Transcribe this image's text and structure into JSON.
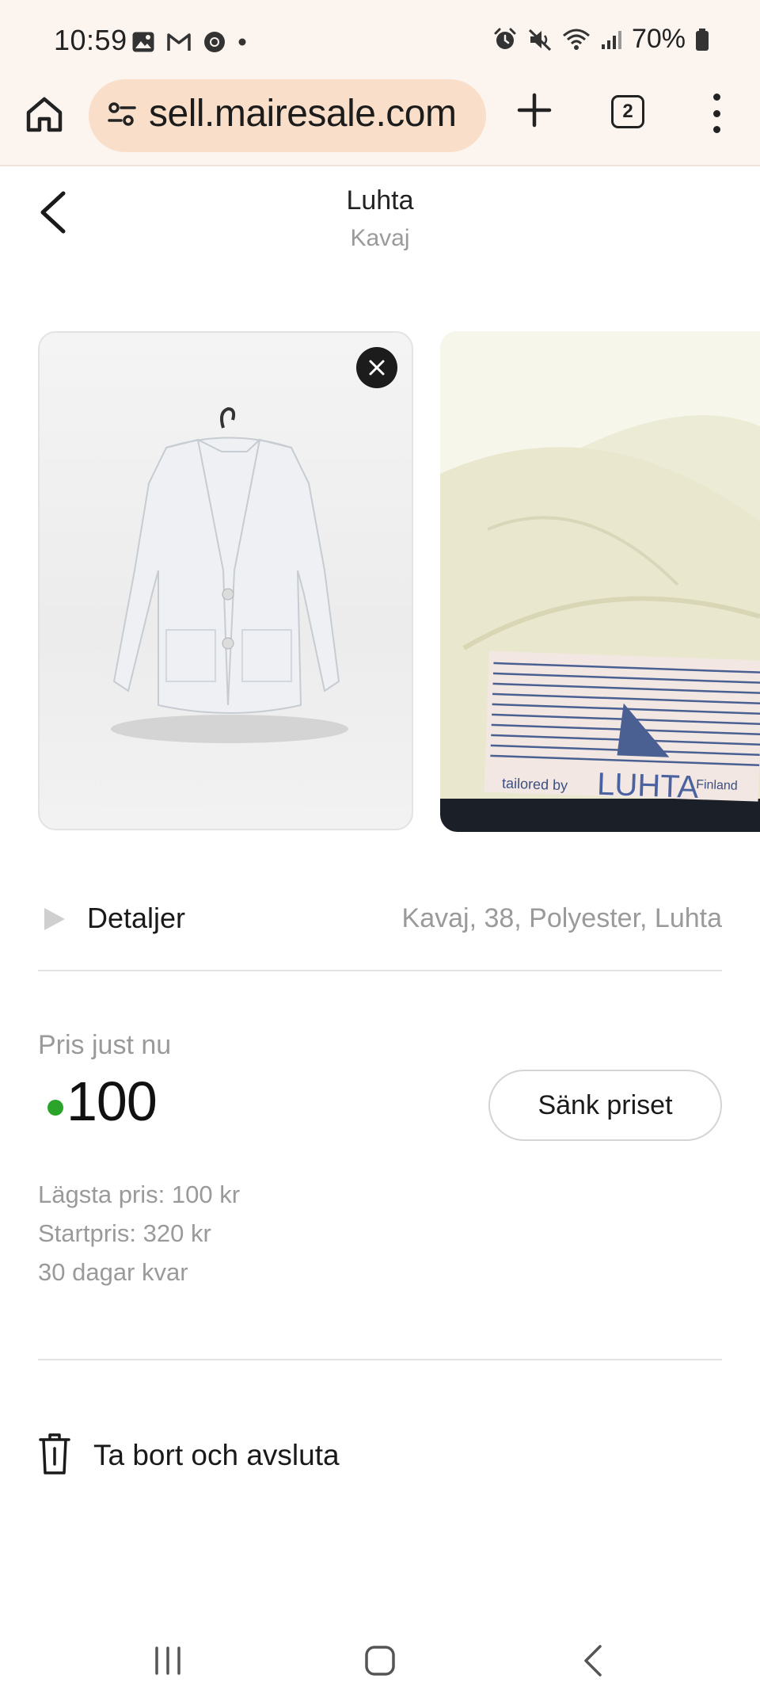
{
  "status_bar": {
    "time": "10:59",
    "battery": "70%"
  },
  "browser": {
    "url": "sell.mairesale.com",
    "tab_count": "2"
  },
  "header": {
    "title": "Luhta",
    "subtitle": "Kavaj"
  },
  "photos": [
    {
      "icon": "jacket-photo"
    },
    {
      "icon": "label-photo"
    }
  ],
  "details": {
    "label": "Detaljer",
    "value": "Kavaj, 38, Polyester, Luhta"
  },
  "price": {
    "label": "Pris just nu",
    "value": "100",
    "status_color": "#2aa52a",
    "lower_button": "Sänk priset",
    "lowest": "Lägsta pris:  100 kr",
    "start": "Startpris:  320 kr",
    "days_left": "30 dagar kvar"
  },
  "remove": {
    "label": "Ta bort och avsluta"
  },
  "colors": {
    "chrome_bg": "#fcf4ef",
    "url_bg": "#f9dfc9",
    "accent_green": "#2aa52a"
  }
}
